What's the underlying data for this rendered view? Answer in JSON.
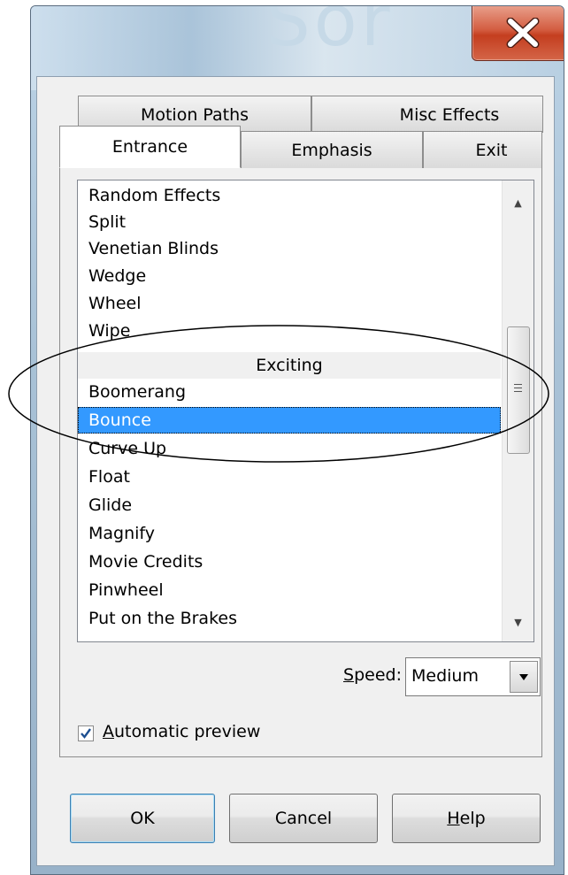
{
  "window": {
    "ghost_title": "Sor",
    "close_icon": "close-icon"
  },
  "tabs": {
    "row1": [
      {
        "label": "Motion Paths"
      },
      {
        "label": "Misc Effects"
      }
    ],
    "row2": [
      {
        "label": "Entrance",
        "active": true
      },
      {
        "label": "Emphasis"
      },
      {
        "label": "Exit"
      }
    ]
  },
  "effects_list": {
    "items": [
      {
        "label": "Random Effects"
      },
      {
        "label": "Split"
      },
      {
        "label": "Venetian Blinds"
      },
      {
        "label": "Wedge"
      },
      {
        "label": "Wheel"
      },
      {
        "label": "Wipe"
      },
      {
        "label": "Exciting",
        "type": "group-header"
      },
      {
        "label": "Boomerang"
      },
      {
        "label": "Bounce",
        "selected": true
      },
      {
        "label": "Curve Up"
      },
      {
        "label": "Float"
      },
      {
        "label": "Glide"
      },
      {
        "label": "Magnify"
      },
      {
        "label": "Movie Credits"
      },
      {
        "label": "Pinwheel"
      },
      {
        "label": "Put on the Brakes"
      }
    ]
  },
  "speed": {
    "label_prefix": "",
    "label_accel": "S",
    "label_rest": "peed:",
    "value": "Medium"
  },
  "automatic_preview": {
    "checked": true,
    "label_accel": "A",
    "label_rest": "utomatic preview"
  },
  "buttons": {
    "ok": "OK",
    "cancel": "Cancel",
    "help_accel": "H",
    "help_rest": "elp"
  },
  "colors": {
    "selection": "#3399ff",
    "close_button": "#c43e1f",
    "dialog_background": "#f0f0f0"
  }
}
